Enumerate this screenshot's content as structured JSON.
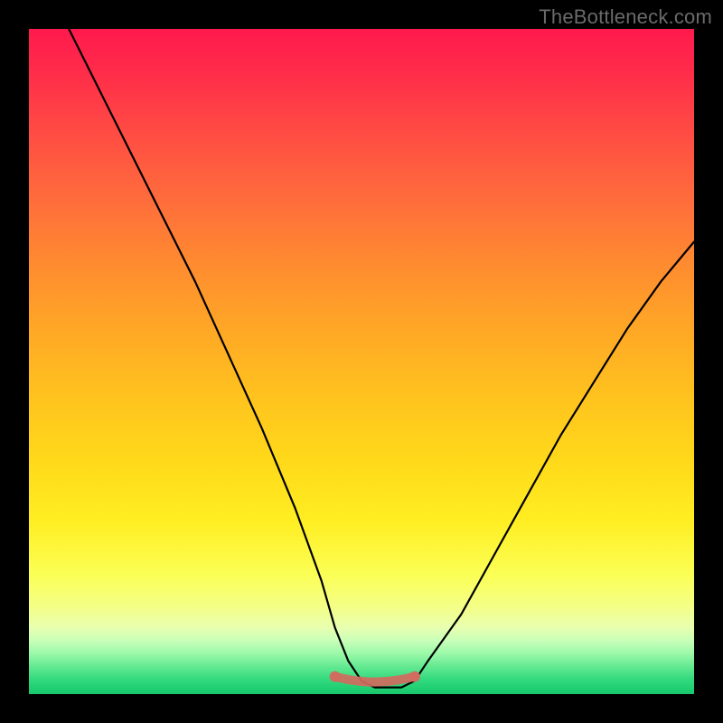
{
  "watermark": "TheBottleneck.com",
  "colors": {
    "frame": "#000000",
    "curve": "#000000",
    "highlight": "#d36a5f"
  },
  "chart_data": {
    "type": "line",
    "title": "",
    "xlabel": "",
    "ylabel": "",
    "xlim": [
      0,
      100
    ],
    "ylim": [
      0,
      100
    ],
    "grid": false,
    "legend": false,
    "annotations": [
      "TheBottleneck.com"
    ],
    "background_gradient": {
      "top": "#ff1a4d",
      "bottom": "#18c86c",
      "note": "vertical red→orange→yellow→green"
    },
    "series": [
      {
        "name": "bottleneck-curve",
        "description": "Asymmetric V-shaped curve; steep left arm, shallower right arm, flat minimum plateau around x≈48–58.",
        "x": [
          6,
          10,
          15,
          20,
          25,
          30,
          35,
          40,
          44,
          46,
          48,
          50,
          52,
          54,
          56,
          58,
          60,
          65,
          70,
          75,
          80,
          85,
          90,
          95,
          100
        ],
        "y": [
          100,
          92,
          82,
          72,
          62,
          51,
          40,
          28,
          17,
          10,
          5,
          2,
          1,
          1,
          1,
          2,
          5,
          12,
          21,
          30,
          39,
          47,
          55,
          62,
          68
        ]
      }
    ],
    "highlight": {
      "name": "trough-highlight",
      "xrange": [
        46,
        58
      ],
      "y": 1,
      "color": "#d36a5f"
    }
  }
}
